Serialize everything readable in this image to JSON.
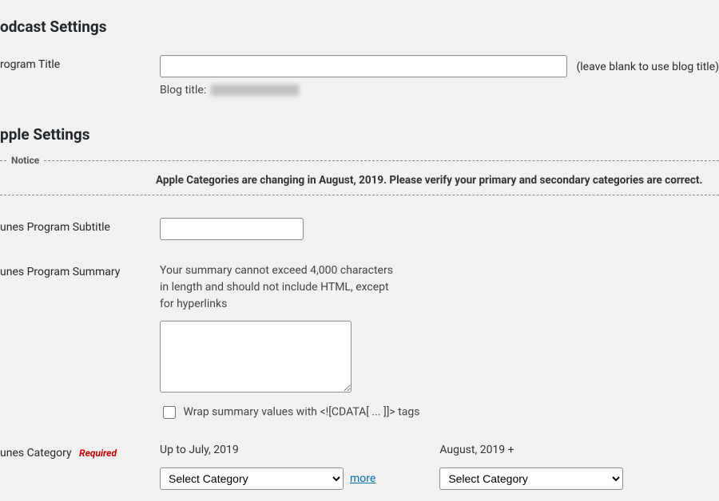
{
  "sections": {
    "podcast_settings": {
      "title": "odcast Settings",
      "program_title": {
        "label": "rogram Title",
        "value": "",
        "hint_right": "(leave blank to use blog title)",
        "blog_title_prefix": "Blog title:"
      }
    },
    "apple_settings": {
      "title": "pple Settings",
      "notice": {
        "legend": "Notice",
        "body": "Apple Categories are changing in August, 2019. Please verify your primary and secondary categories are correct."
      },
      "subtitle": {
        "label": "unes Program Subtitle",
        "value": ""
      },
      "summary": {
        "label": "unes Program Summary",
        "desc": "Your summary cannot exceed 4,000 characters in length and should not include HTML, except for hyperlinks",
        "value": "",
        "checkbox_label": "Wrap summary values with <![CDATA[ ... ]]> tags"
      },
      "category": {
        "label": "unes Category",
        "required_text": "Required",
        "old_col_label": "Up to July, 2019",
        "new_col_label": "August, 2019 +",
        "placeholder": "Select Category",
        "more_text": "more"
      }
    }
  }
}
